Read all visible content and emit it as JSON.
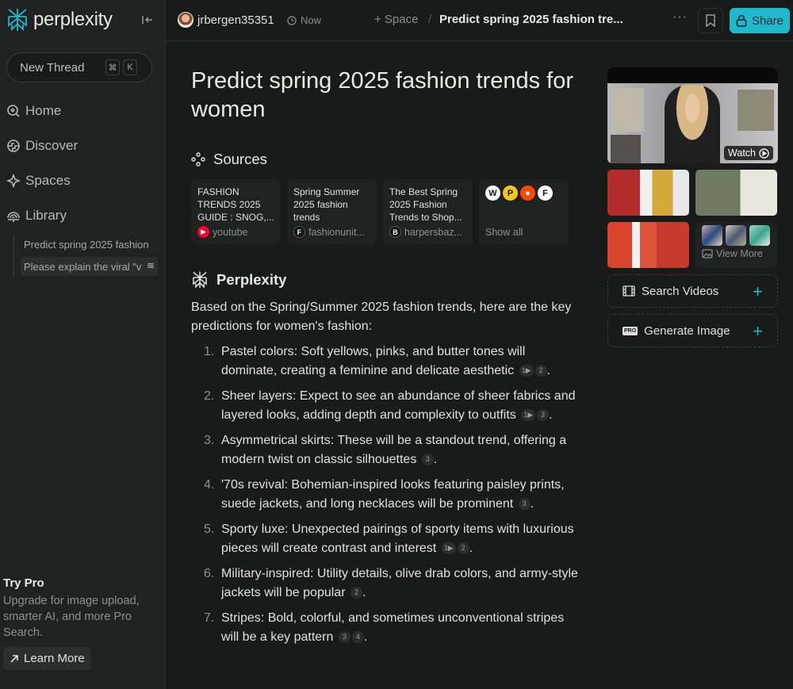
{
  "app": {
    "brand": "perplexity",
    "accent_color": "#20b8cd"
  },
  "sidebar": {
    "new_thread_label": "New Thread",
    "shortcut_keys": [
      "⌘",
      "K"
    ],
    "nav": [
      {
        "label": "Home",
        "icon": "home-search-icon"
      },
      {
        "label": "Discover",
        "icon": "globe-icon"
      },
      {
        "label": "Spaces",
        "icon": "sparkle-icon"
      },
      {
        "label": "Library",
        "icon": "library-icon"
      }
    ],
    "library_threads": [
      {
        "label": "Predict spring 2025 fashion",
        "active": false
      },
      {
        "label": "Please explain the viral \"v",
        "active": true
      }
    ],
    "try_pro": {
      "title": "Try Pro",
      "description": "Upgrade for image upload, smarter AI, and more Pro Search.",
      "button_label": "Learn More"
    }
  },
  "topbar": {
    "username": "jrbergen35351",
    "time": "Now",
    "space_label": "+ Space",
    "separator": "/",
    "thread_title": "Predict spring 2025 fashion tre...",
    "more_label": "···",
    "share_label": "Share"
  },
  "main": {
    "title": "Predict spring 2025 fashion trends for women",
    "sources_heading": "Sources",
    "sources": [
      {
        "title": "FASHION TRENDS 2025 GUIDE : SNOG,...",
        "site": "youtube",
        "icon_color": "#ff0033",
        "icon_glyph": "▶"
      },
      {
        "title": "Spring Summer 2025 fashion trends",
        "site": "fashionunit...",
        "icon_color": "#111111",
        "icon_glyph": "F"
      },
      {
        "title": "The Best Spring 2025 Fashion Trends to Shop...",
        "site": "harpersbaz...",
        "icon_color": "#111111",
        "icon_glyph": "B"
      }
    ],
    "show_all": {
      "label": "Show all",
      "icons": [
        {
          "glyph": "W",
          "bg": "#ffffff",
          "fg": "#111111"
        },
        {
          "glyph": "P",
          "bg": "#f2c81b",
          "fg": "#111111"
        },
        {
          "glyph": "●",
          "bg": "#ff4500",
          "fg": "#ffffff"
        },
        {
          "glyph": "F",
          "bg": "#ffffff",
          "fg": "#111111"
        }
      ]
    },
    "answer_heading": "Perplexity",
    "intro": "Based on the Spring/Summer 2025 fashion trends, here are the key predictions for women's fashion:",
    "items": [
      {
        "num": "1.",
        "text": "Pastel colors: Soft yellows, pinks, and butter tones will dominate, creating a feminine and delicate aesthetic",
        "citations": [
          "1▶",
          "2"
        ]
      },
      {
        "num": "2.",
        "text": "Sheer layers: Expect to see an abundance of sheer fabrics and layered looks, adding depth and complexity to outfits",
        "citations": [
          "1▶",
          "3"
        ]
      },
      {
        "num": "3.",
        "text": "Asymmetrical skirts: These will be a standout trend, offering a modern twist on classic silhouettes",
        "citations": [
          "3"
        ]
      },
      {
        "num": "4.",
        "text": "'70s revival: Bohemian-inspired looks featuring paisley prints, suede jackets, and long necklaces will be prominent",
        "citations": [
          "3"
        ]
      },
      {
        "num": "5.",
        "text": "Sporty luxe: Unexpected pairings of sporty items with luxurious pieces will create contrast and interest",
        "citations": [
          "1▶",
          "2"
        ]
      },
      {
        "num": "6.",
        "text": "Military-inspired: Utility details, olive drab colors, and army-style jackets will be popular",
        "citations": [
          "2"
        ]
      },
      {
        "num": "7.",
        "text": "Stripes: Bold, colorful, and sometimes unconventional stripes will be a key pattern",
        "citations": [
          "3",
          "4"
        ]
      }
    ]
  },
  "media": {
    "watch_label": "Watch",
    "view_more_label": "View More",
    "actions": [
      {
        "label": "Search Videos",
        "icon": "film-icon"
      },
      {
        "label": "Generate Image",
        "icon": "pro-badge-icon",
        "badge": "PRO"
      }
    ],
    "plus": "+"
  }
}
